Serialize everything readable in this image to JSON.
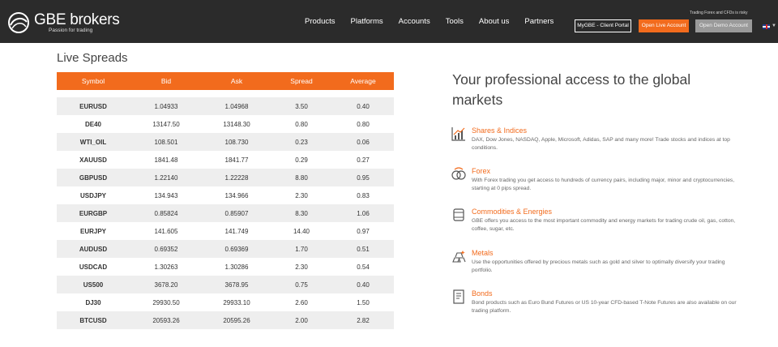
{
  "header": {
    "logo_name": "GBE brokers",
    "logo_tagline": "Passion for trading",
    "nav": [
      "Products",
      "Platforms",
      "Accounts",
      "Tools",
      "About us",
      "Partners"
    ],
    "client_portal_label": "MyGBE - Client Portal",
    "open_live_label": "Open Live Account",
    "open_demo_label": "Open Demo Account",
    "risk_text": "Trading Forex and CFDs is risky",
    "language_icon": "uk-flag-icon",
    "accent_color": "#f26b1d"
  },
  "spreads": {
    "title": "Live Spreads",
    "columns": [
      "Symbol",
      "Bid",
      "Ask",
      "Spread",
      "Average"
    ],
    "rows": [
      [
        "EURUSD",
        "1.04933",
        "1.04968",
        "3.50",
        "0.40"
      ],
      [
        "DE40",
        "13147.50",
        "13148.30",
        "0.80",
        "0.80"
      ],
      [
        "WTI_OIL",
        "108.501",
        "108.730",
        "0.23",
        "0.06"
      ],
      [
        "XAUUSD",
        "1841.48",
        "1841.77",
        "0.29",
        "0.27"
      ],
      [
        "GBPUSD",
        "1.22140",
        "1.22228",
        "8.80",
        "0.95"
      ],
      [
        "USDJPY",
        "134.943",
        "134.966",
        "2.30",
        "0.83"
      ],
      [
        "EURGBP",
        "0.85824",
        "0.85907",
        "8.30",
        "1.06"
      ],
      [
        "EURJPY",
        "141.605",
        "141.749",
        "14.40",
        "0.97"
      ],
      [
        "AUDUSD",
        "0.69352",
        "0.69369",
        "1.70",
        "0.51"
      ],
      [
        "USDCAD",
        "1.30263",
        "1.30286",
        "2.30",
        "0.54"
      ],
      [
        "US500",
        "3678.20",
        "3678.95",
        "0.75",
        "0.40"
      ],
      [
        "DJ30",
        "29930.50",
        "29933.10",
        "2.60",
        "1.50"
      ],
      [
        "BTCUSD",
        "20593.26",
        "20595.26",
        "2.00",
        "2.82"
      ]
    ]
  },
  "promo": {
    "headline": "Your professional access to the global markets",
    "features": [
      {
        "icon": "chart-icon",
        "title": "Shares & Indices",
        "desc": "DAX, Dow Jones, NASDAQ, Apple, Microsoft, Adidas, SAP and many more! Trade stocks and indices at top conditions."
      },
      {
        "icon": "currency-exchange-icon",
        "title": "Forex",
        "desc": "With Forex trading you get access to hundreds of currency pairs, including major, minor and cryptocurrencies, starting at 0 pips spread."
      },
      {
        "icon": "barrels-icon",
        "title": "Commodities & Energies",
        "desc": "GBE offers you access to the most important commodity and energy markets for trading crude oil, gas, cotton, coffee, sugar, etc."
      },
      {
        "icon": "gold-bars-icon",
        "title": "Metals",
        "desc": "Use the opportunities offered by precious metals such as gold and silver to optimally diversify your trading portfolio."
      },
      {
        "icon": "document-icon",
        "title": "Bonds",
        "desc": "Bond products such as Euro Bund Futures or US 10-year CFD-based T-Note Futures are also available on our trading platform."
      }
    ]
  }
}
